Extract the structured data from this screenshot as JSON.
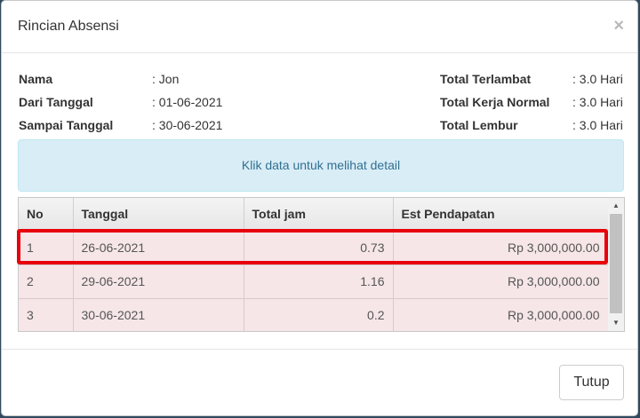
{
  "modal": {
    "title": "Rincian Absensi",
    "close_symbol": "×"
  },
  "info_left": [
    {
      "label": "Nama",
      "value": ": Jon"
    },
    {
      "label": "Dari Tanggal",
      "value": ": 01-06-2021"
    },
    {
      "label": "Sampai Tanggal",
      "value": ": 30-06-2021"
    }
  ],
  "info_right": [
    {
      "label": "Total Terlambat",
      "value": ": 3.0 Hari"
    },
    {
      "label": "Total Kerja Normal",
      "value": ": 3.0 Hari"
    },
    {
      "label": "Total Lembur",
      "value": ": 3.0 Hari"
    }
  ],
  "alert": {
    "text": "Klik data untuk melihat detail"
  },
  "table": {
    "headers": [
      "No",
      "Tanggal",
      "Total jam",
      "Est Pendapatan"
    ],
    "rows": [
      [
        "1",
        "26-06-2021",
        "0.73",
        "Rp 3,000,000.00"
      ],
      [
        "2",
        "29-06-2021",
        "1.16",
        "Rp 3,000,000.00"
      ],
      [
        "3",
        "30-06-2021",
        "0.2",
        "Rp 3,000,000.00"
      ]
    ],
    "highlighted_row": 1
  },
  "footer": {
    "close_button": "Tutup"
  },
  "colors": {
    "alert_bg": "#d9edf7",
    "alert_text": "#31708f",
    "row_bg": "#f6e6e8",
    "highlight": "#e8000b"
  }
}
